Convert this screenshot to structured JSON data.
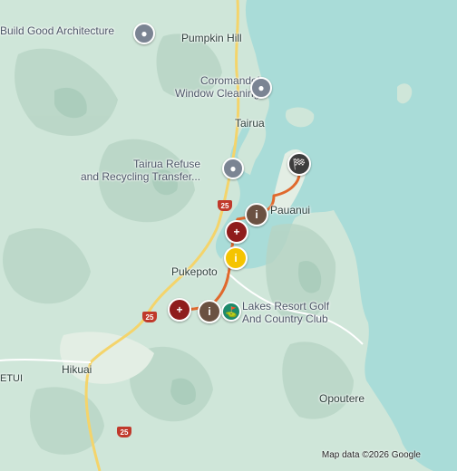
{
  "places": {
    "pumpkin_hill": "Pumpkin Hill",
    "tairua": "Tairua",
    "pauanui": "Pauanui",
    "pukepoto": "Pukepoto",
    "hikuai": "Hikuai",
    "opoutere": "Opoutere",
    "edge_left": "ETUI"
  },
  "pois": {
    "build_good": "Build Good Architecture",
    "coromandel_line1": "Coromandel",
    "coromandel_line2": "Window Cleaning",
    "refuse_line1": "Tairua Refuse",
    "refuse_line2": "and Recycling Transfer...",
    "lakes_line1": "Lakes Resort Golf",
    "lakes_line2": "And Country Club"
  },
  "roads": {
    "route_a": "25",
    "route_b": "25",
    "route_c": "25"
  },
  "markers": {
    "info_glyph": "i",
    "medical_glyph": "+",
    "golf_glyph": "⛳",
    "finish_glyph": "🏁"
  },
  "attribution": "Map data ©2026 Google",
  "colors": {
    "water": "#a9dcd8",
    "land": "#cfe6d9",
    "route": "#e0692d",
    "road_highway": "#f4d46b",
    "info_marker": "#6b5142",
    "medical_marker": "#8f1c1c",
    "yellow_marker": "#f5c400",
    "finish_marker": "#3d3d3d",
    "poi_marker": "#7b8493",
    "golf_marker": "#1e8a6a"
  }
}
